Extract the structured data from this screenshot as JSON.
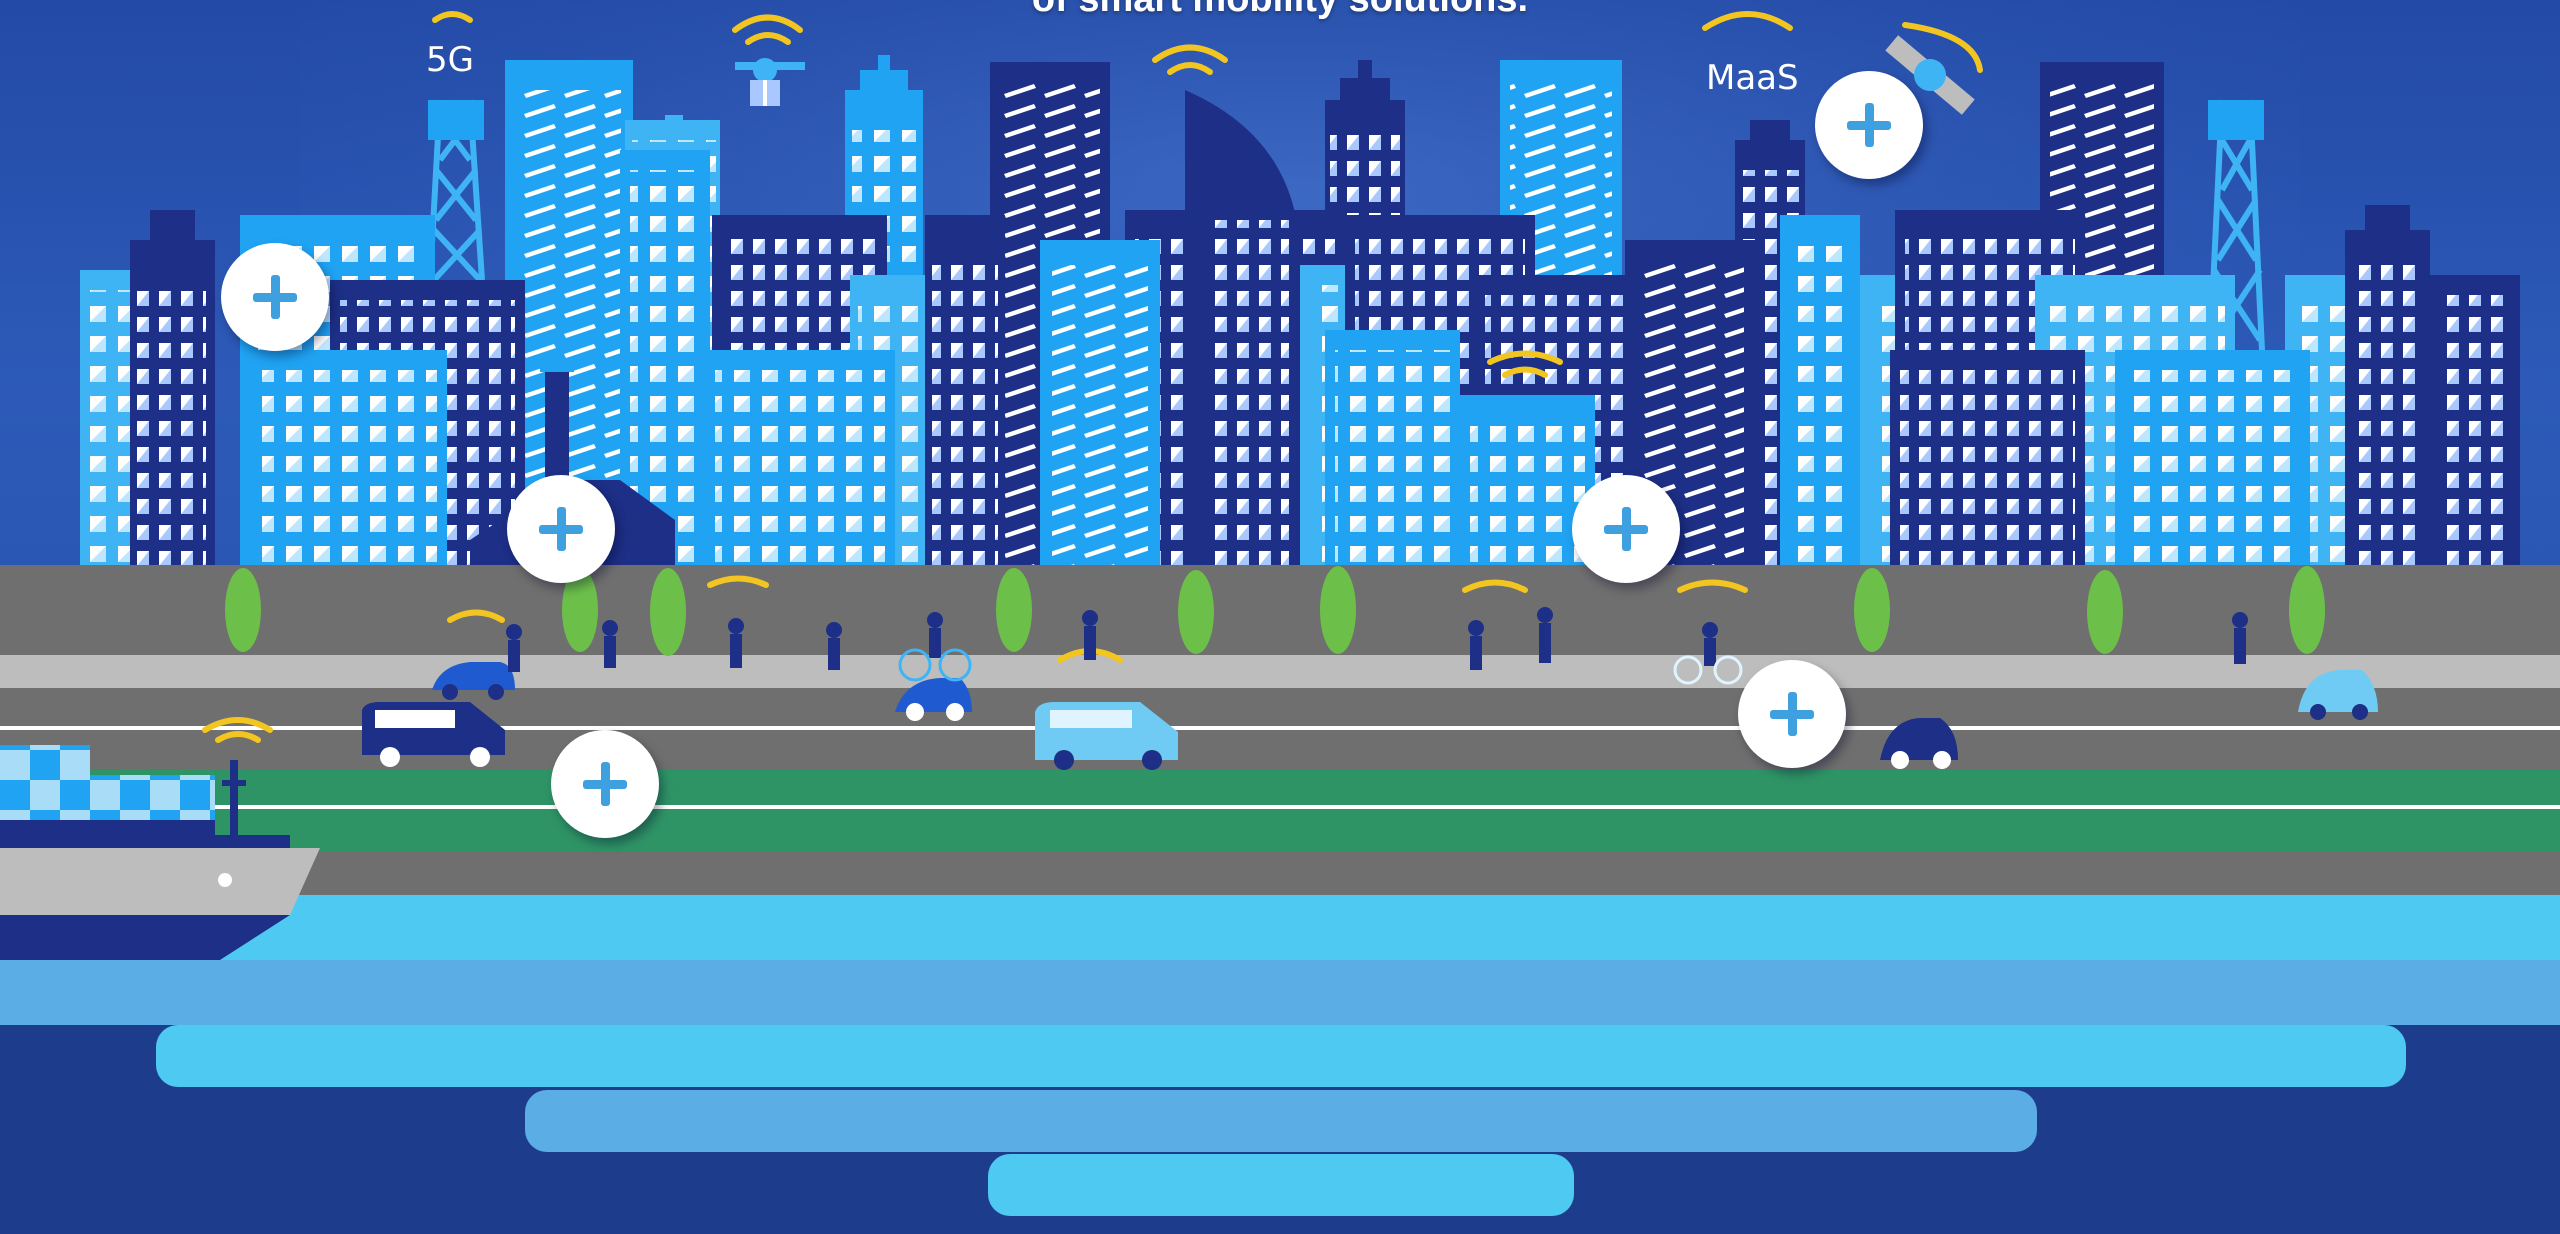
{
  "headline": "of smart mobility solutions.",
  "labels": {
    "fiveg": "5G",
    "maas": "MaaS"
  },
  "hotspots": [
    {
      "name": "hotspot-5g-tower",
      "icon": "plus-icon"
    },
    {
      "name": "hotspot-charging-station",
      "icon": "plus-icon"
    },
    {
      "name": "hotspot-maas-satellite",
      "icon": "plus-icon"
    },
    {
      "name": "hotspot-city-building",
      "icon": "plus-icon"
    },
    {
      "name": "hotspot-road-traffic",
      "icon": "plus-icon"
    },
    {
      "name": "hotspot-rail-line",
      "icon": "plus-icon"
    }
  ],
  "colors": {
    "sky": "#2a55b4",
    "building_light": "#1fa3f2",
    "building_dark": "#1d2f86",
    "window": "#ffffff",
    "road": "#6f6f6f",
    "rail": "#2e9465",
    "water_light": "#4ecaf2",
    "water_mid": "#5aaee5",
    "signal": "#f2c520",
    "hotspot_plus": "#3fa0e0"
  }
}
